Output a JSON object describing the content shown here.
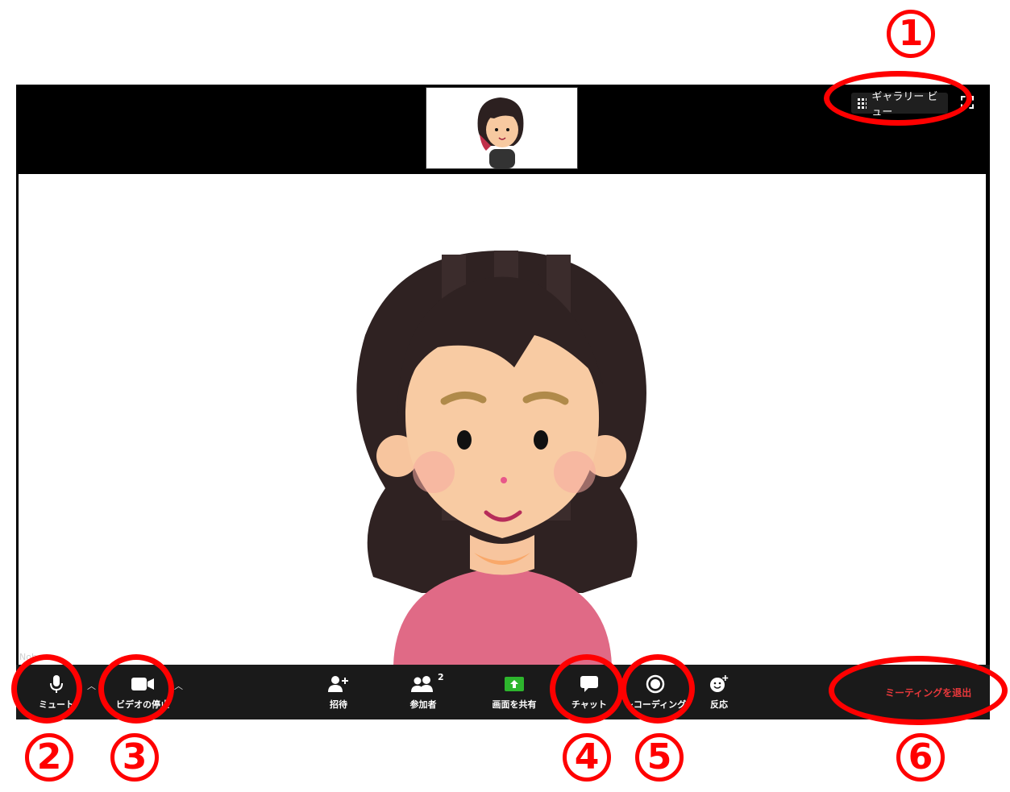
{
  "header": {
    "view_label": "ギャラリー ビュー",
    "fullscreen_icon": "fullscreen-icon"
  },
  "participant": {
    "name": "Nob... ..."
  },
  "toolbar": {
    "mute_label": "ミュート",
    "video_label": "ビデオの停止",
    "invite_label": "招待",
    "participants_label": "参加者",
    "participants_count": "2",
    "share_label": "画面を共有",
    "chat_label": "チャット",
    "record_label": "レコーディング",
    "reaction_label": "反応",
    "leave_label": "ミーティングを退出"
  },
  "annotations": {
    "n1": "1",
    "n2": "2",
    "n3": "3",
    "n4": "4",
    "n5": "5",
    "n6": "6"
  },
  "colors": {
    "annotation": "#ff0000",
    "leave": "#e8383b",
    "share": "#2db52d"
  }
}
